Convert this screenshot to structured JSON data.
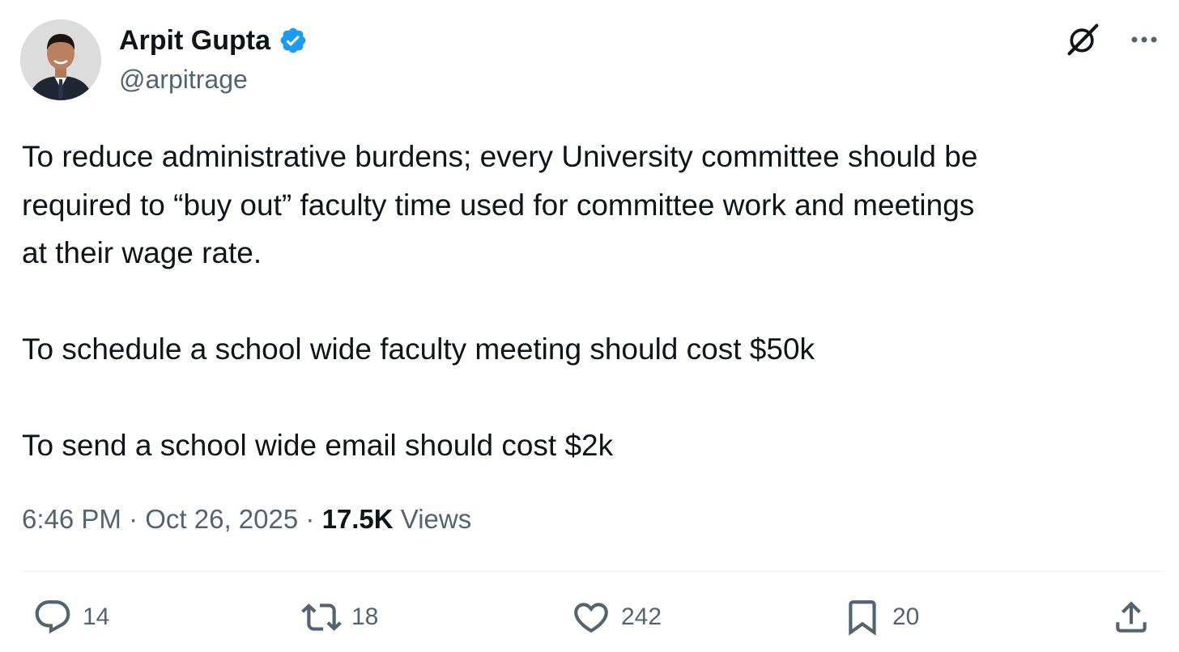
{
  "author": {
    "name": "Arpit Gupta",
    "handle": "@arpitrage",
    "verified": true,
    "verified_color": "#1d9bf0",
    "avatar_icon": "profile-photo"
  },
  "top_actions": {
    "grok_icon": "grok-icon",
    "more_icon": "more-icon"
  },
  "tweet": {
    "paragraph1": "To reduce administrative burdens; every University committee should be\nrequired to “buy out” faculty time used for committee work and meetings\nat their wage rate.",
    "paragraph2": "To schedule a school wide faculty meeting should cost $50k",
    "paragraph3": "To send a school wide email should cost $2k"
  },
  "meta": {
    "time": "6:46 PM",
    "separator": "·",
    "date": "Oct 26, 2025",
    "views_count": "17.5K",
    "views_label": "Views"
  },
  "actions": {
    "replies": "14",
    "reposts": "18",
    "likes": "242",
    "bookmarks": "20"
  }
}
